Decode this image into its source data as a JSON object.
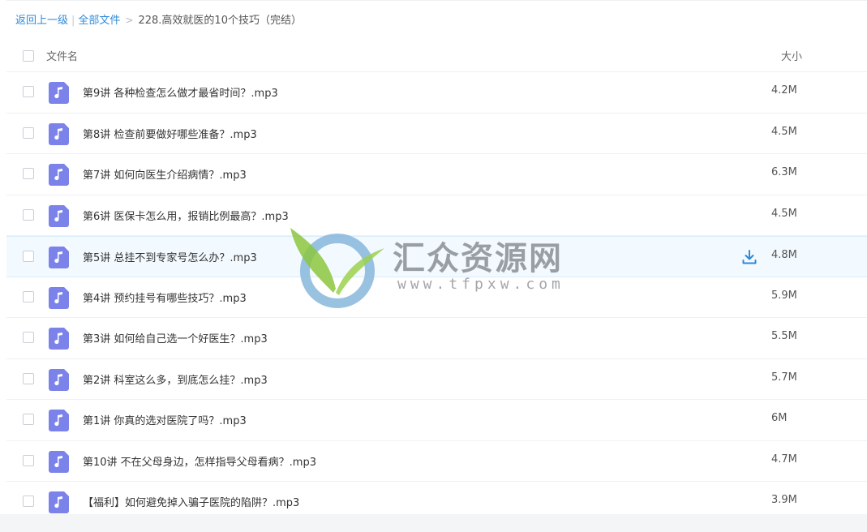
{
  "breadcrumb": {
    "back": "返回上一级",
    "separator": "|",
    "all_files": "全部文件",
    "arrow": ">",
    "current": "228.高效就医的10个技巧（完结）"
  },
  "header": {
    "name_col": "文件名",
    "size_col": "大小"
  },
  "files": [
    {
      "name": "第9讲 各种检查怎么做才最省时间？.mp3",
      "size": "4.2M"
    },
    {
      "name": "第8讲 检查前要做好哪些准备？.mp3",
      "size": "4.5M"
    },
    {
      "name": "第7讲 如何向医生介绍病情？.mp3",
      "size": "6.3M"
    },
    {
      "name": "第6讲 医保卡怎么用，报销比例最高？.mp3",
      "size": "4.5M"
    },
    {
      "name": "第5讲 总挂不到专家号怎么办？.mp3",
      "size": "4.8M"
    },
    {
      "name": "第4讲 预约挂号有哪些技巧？.mp3",
      "size": "5.9M"
    },
    {
      "name": "第3讲 如何给自己选一个好医生？.mp3",
      "size": "5.5M"
    },
    {
      "name": "第2讲 科室这么多，到底怎么挂？.mp3",
      "size": "5.7M"
    },
    {
      "name": "第1讲 你真的选对医院了吗？.mp3",
      "size": "6M"
    },
    {
      "name": "第10讲 不在父母身边，怎样指导父母看病？.mp3",
      "size": "4.7M"
    },
    {
      "name": "【福利】如何避免掉入骗子医院的陷阱？.mp3",
      "size": "3.9M"
    }
  ],
  "hover_row_index": 4,
  "icons": {
    "file": "music-note-icon",
    "download": "download-icon"
  },
  "watermark": {
    "title": "汇众资源网",
    "url": "www.tfpxw.com"
  },
  "colors": {
    "link": "#2f8ad8",
    "file_icon": "#7b83eb",
    "hover_row": "#f3faff",
    "download": "#2f8ad8"
  }
}
